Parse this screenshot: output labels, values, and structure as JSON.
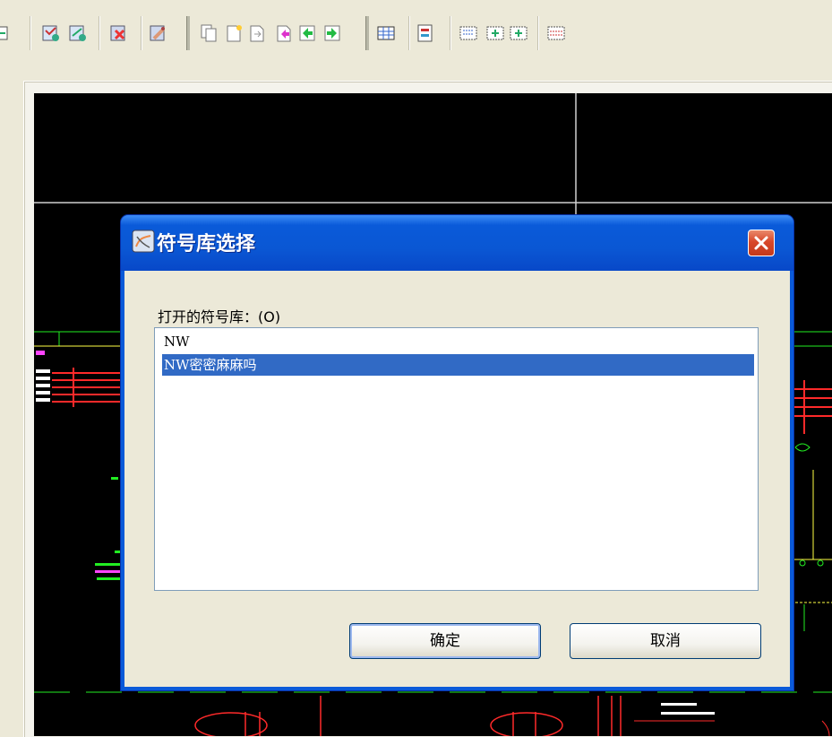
{
  "dialog": {
    "title": "符号库选择",
    "open_libraries_label": "打开的符号库：(O)",
    "libraries": [
      {
        "label": "NW",
        "selected": false
      },
      {
        "label": "NW密密麻麻吗",
        "selected": true
      }
    ],
    "ok_label": "确定",
    "cancel_label": "取消"
  },
  "toolbar": {
    "icons": [
      "grid-view-icon",
      "draw-wire-icon",
      "draw-symbol-icon",
      "erase-icon",
      "brush-icon",
      "copy-page-icon",
      "new-page-icon",
      "page-forward-icon",
      "page-back-icon",
      "arrow-left-icon",
      "arrow-right-icon",
      "grid-icon",
      "component-icon",
      "terminal-icon",
      "terminal-group-icon",
      "terminal-group-2-icon",
      "terminal-strip-icon"
    ]
  },
  "colors": {
    "canvas_bg": "#000000",
    "wire_red": "#ff2a2a",
    "wire_green": "#22ee22",
    "dialog_blue": "#0a5ad9",
    "selection": "#316ac5"
  }
}
